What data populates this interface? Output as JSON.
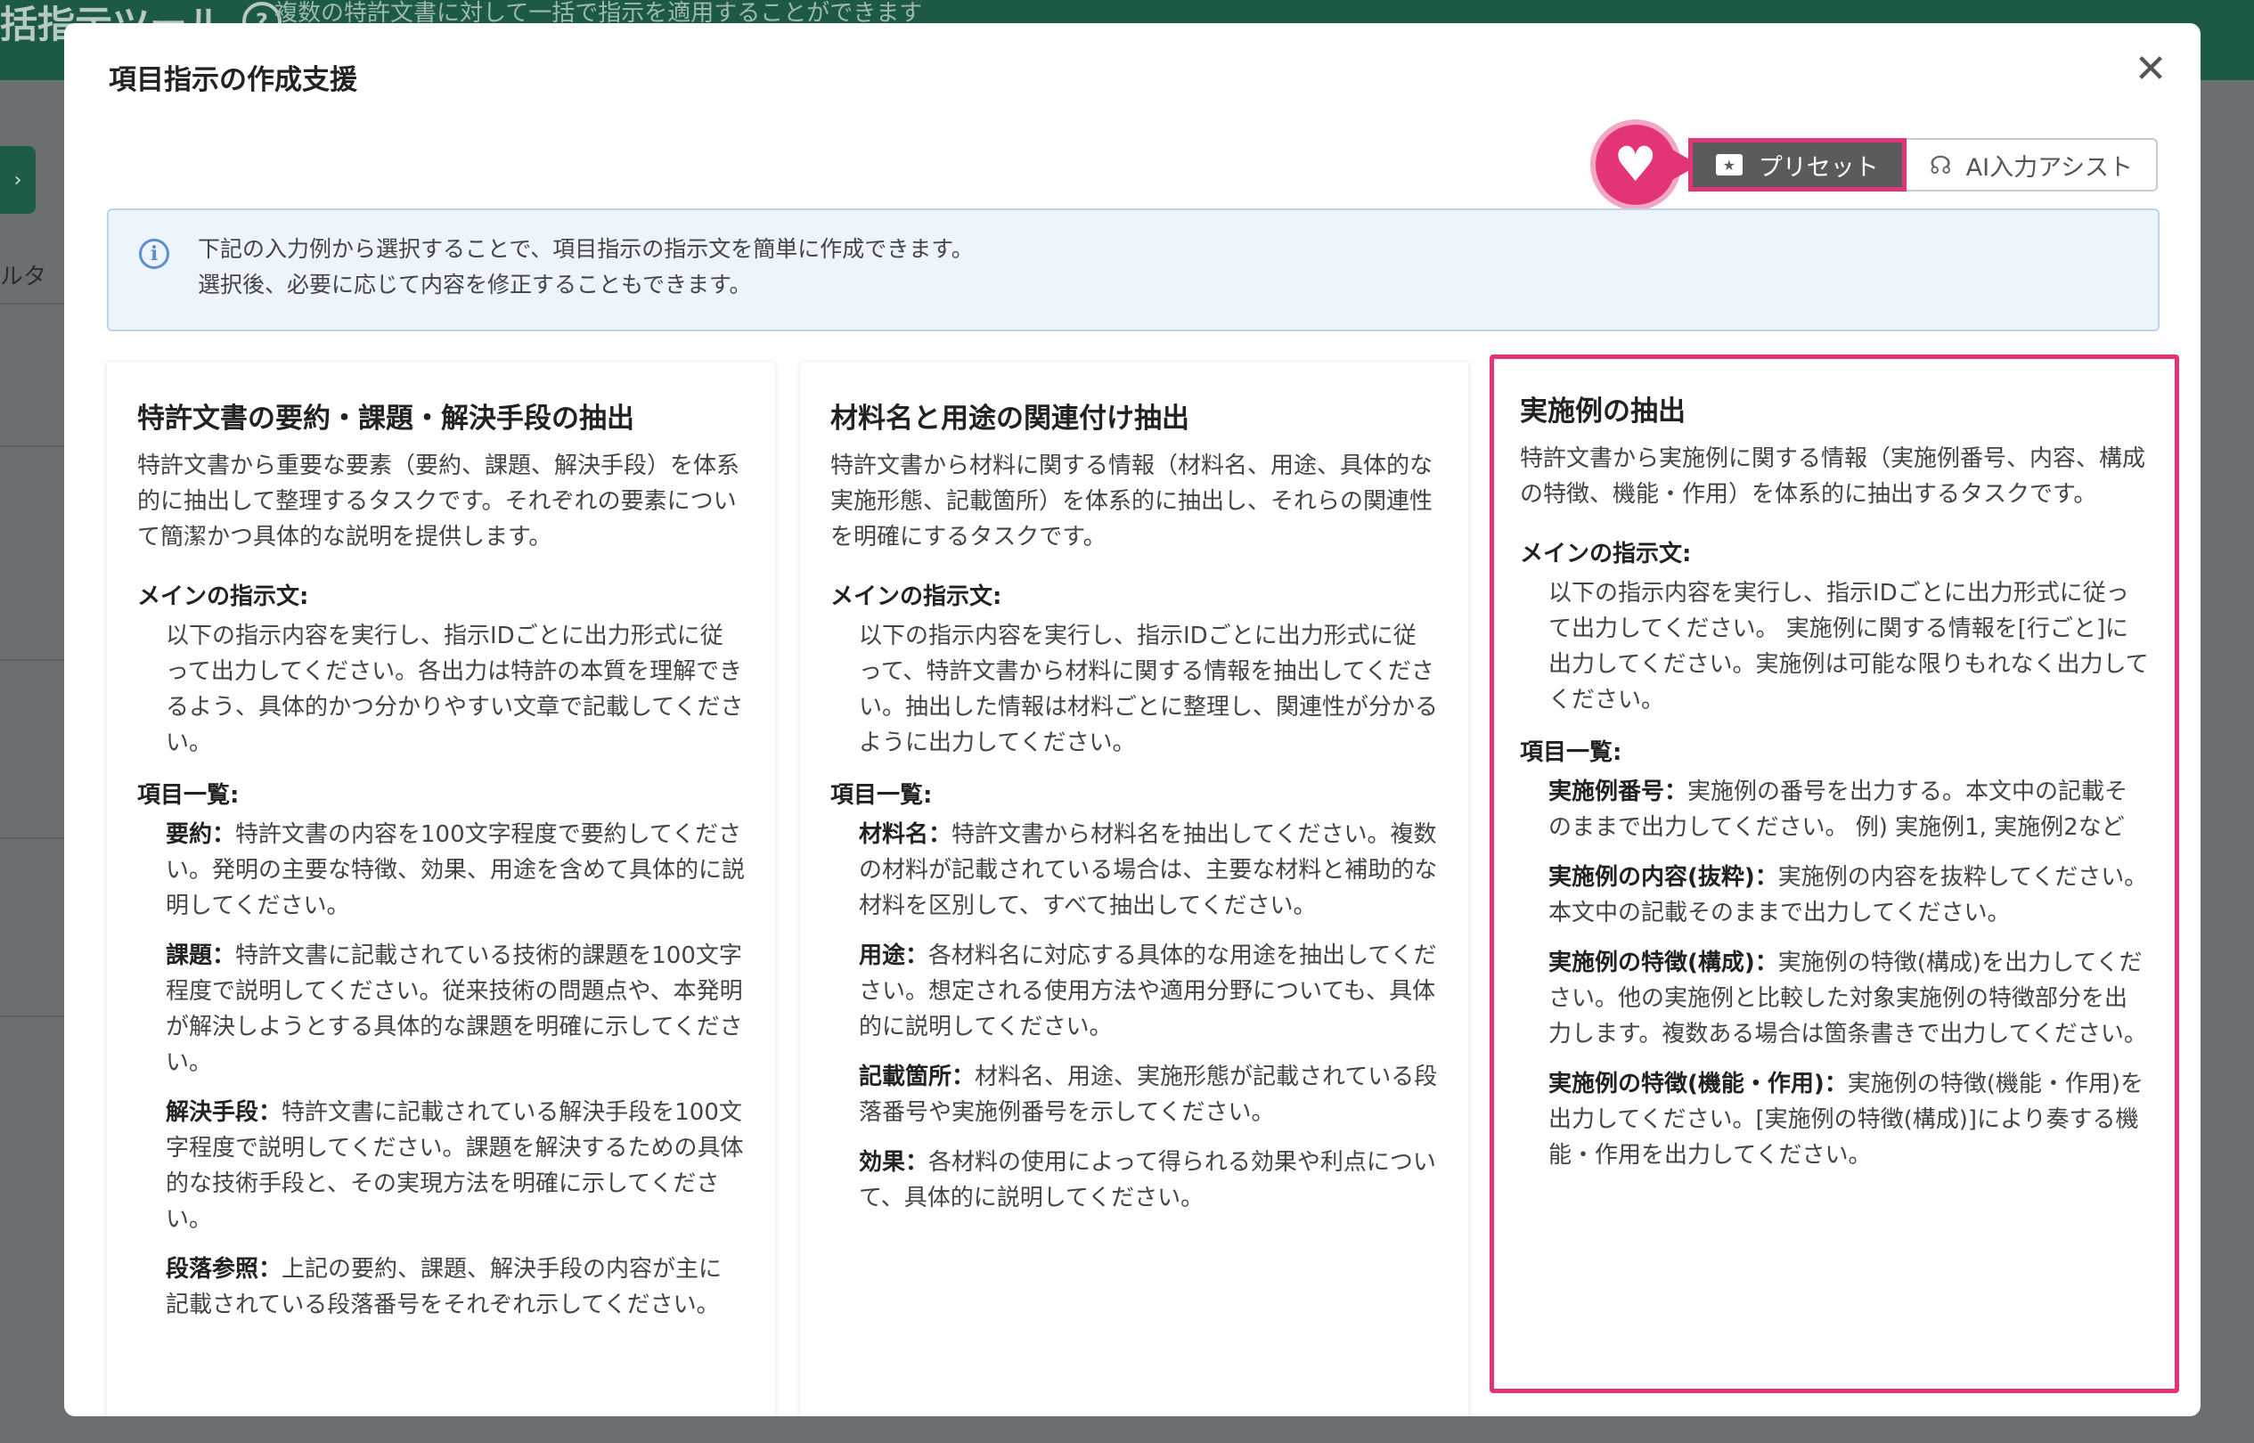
{
  "background": {
    "app_title": "括指示ツール",
    "app_description": "複数の特許文書に対して一括で指示を適用することができます",
    "filter_label": "ルタ"
  },
  "modal": {
    "title": "項目指示の作成支援",
    "close_icon": "close-icon",
    "toolbar": {
      "preset_label": "プリセット",
      "ai_assist_label": "AI入力アシスト"
    },
    "info": {
      "line1": "下記の入力例から選択することで、項目指示の指示文を簡単に作成できます。",
      "line2": "選択後、必要に応じて内容を修正することもできます。"
    },
    "cards": [
      {
        "title": "特許文書の要約・課題・解決手段の抽出",
        "description": "特許文書から重要な要素（要約、課題、解決手段）を体系的に抽出して整理するタスクです。それぞれの要素について簡潔かつ具体的な説明を提供します。",
        "main_label": "メインの指示文:",
        "main_text": "以下の指示内容を実行し、指示IDごとに出力形式に従って出力してください。各出力は特許の本質を理解できるよう、具体的かつ分かりやすい文章で記載してください。",
        "items_label": "項目一覧:",
        "items": [
          {
            "name": "要約：",
            "text": "特許文書の内容を100文字程度で要約してください。発明の主要な特徴、効果、用途を含めて具体的に説明してください。"
          },
          {
            "name": "課題：",
            "text": "特許文書に記載されている技術的課題を100文字程度で説明してください。従来技術の問題点や、本発明が解決しようとする具体的な課題を明確に示してください。"
          },
          {
            "name": "解決手段：",
            "text": "特許文書に記載されている解決手段を100文字程度で説明してください。課題を解決するための具体的な技術手段と、その実現方法を明確に示してください。"
          },
          {
            "name": "段落参照：",
            "text": "上記の要約、課題、解決手段の内容が主に記載されている段落番号をそれぞれ示してください。"
          }
        ]
      },
      {
        "title": "材料名と用途の関連付け抽出",
        "description": "特許文書から材料に関する情報（材料名、用途、具体的な実施形態、記載箇所）を体系的に抽出し、それらの関連性を明確にするタスクです。",
        "main_label": "メインの指示文:",
        "main_text": "以下の指示内容を実行し、指示IDごとに出力形式に従って、特許文書から材料に関する情報を抽出してください。抽出した情報は材料ごとに整理し、関連性が分かるように出力してください。",
        "items_label": "項目一覧:",
        "items": [
          {
            "name": "材料名：",
            "text": "特許文書から材料名を抽出してください。複数の材料が記載されている場合は、主要な材料と補助的な材料を区別して、すべて抽出してください。"
          },
          {
            "name": "用途：",
            "text": "各材料名に対応する具体的な用途を抽出してください。想定される使用方法や適用分野についても、具体的に説明してください。"
          },
          {
            "name": "記載箇所：",
            "text": "材料名、用途、実施形態が記載されている段落番号や実施例番号を示してください。"
          },
          {
            "name": "効果：",
            "text": "各材料の使用によって得られる効果や利点について、具体的に説明してください。"
          }
        ]
      },
      {
        "title": "実施例の抽出",
        "description": "特許文書から実施例に関する情報（実施例番号、内容、構成の特徴、機能・作用）を体系的に抽出するタスクです。",
        "main_label": "メインの指示文:",
        "main_text": "以下の指示内容を実行し、指示IDごとに出力形式に従って出力してください。 実施例に関する情報を[行ごと]に出力してください。実施例は可能な限りもれなく出力してください。",
        "items_label": "項目一覧:",
        "items": [
          {
            "name": "実施例番号：",
            "text": "実施例の番号を出力する。本文中の記載そのままで出力してください。 例) 実施例1, 実施例2など"
          },
          {
            "name": "実施例の内容(抜粋)：",
            "text": "実施例の内容を抜粋してください。本文中の記載そのままで出力してください。"
          },
          {
            "name": "実施例の特徴(構成)：",
            "text": "実施例の特徴(構成)を出力してください。他の実施例と比較した対象実施例の特徴部分を出力します。複数ある場合は箇条書きで出力してください。"
          },
          {
            "name": "実施例の特徴(機能・作用)：",
            "text": "実施例の特徴(機能・作用)を出力してください。[実施例の特徴(構成)]により奏する機能・作用を出力してください。"
          }
        ]
      }
    ],
    "highlight_color": "#e23477"
  }
}
